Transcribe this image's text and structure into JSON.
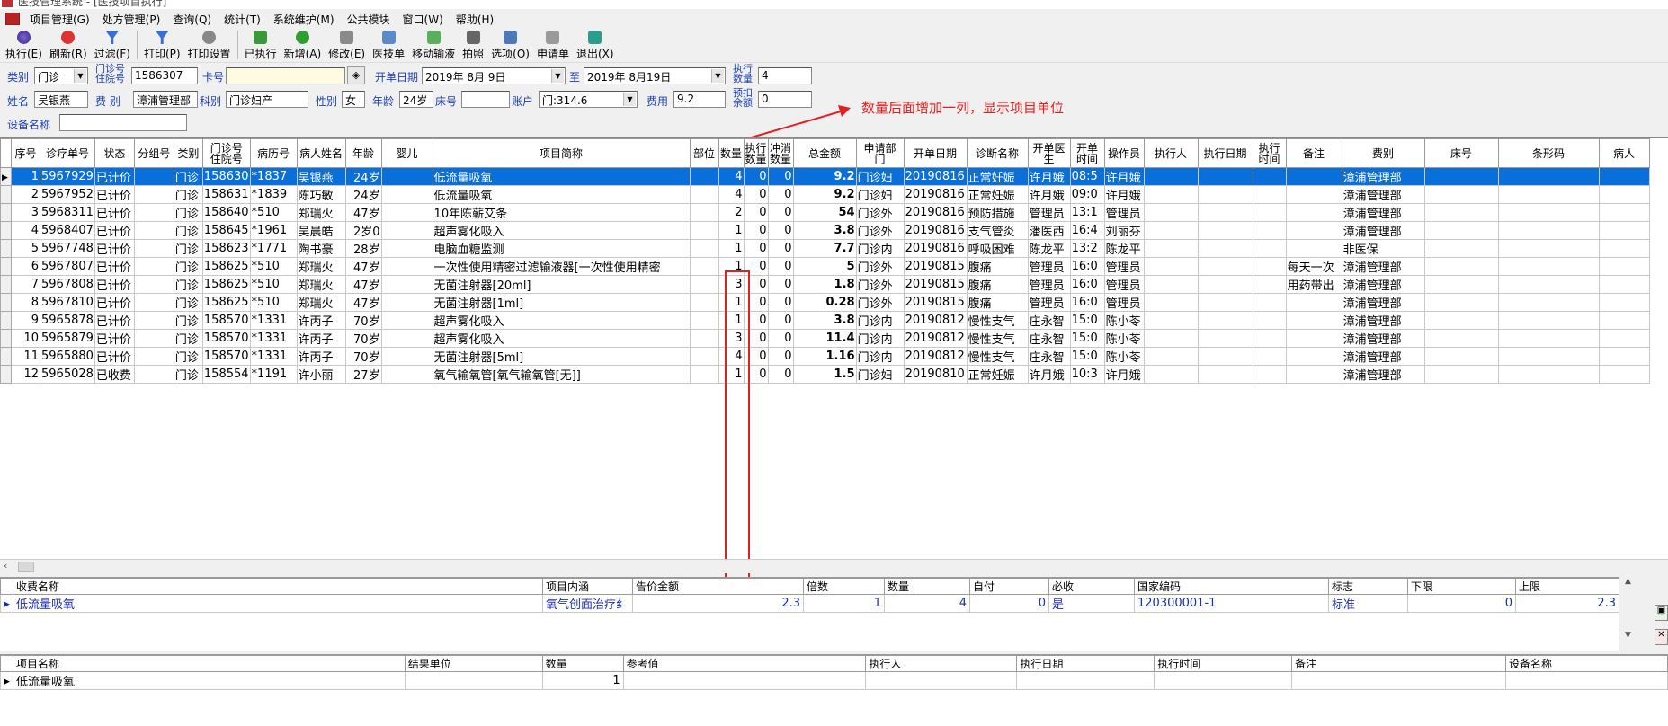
{
  "window": {
    "title": "医技管理系统 - [医技项目执行]"
  },
  "menu": [
    "项目管理(G)",
    "处方管理(P)",
    "查询(Q)",
    "统计(T)",
    "系统维护(M)",
    "公共模块",
    "窗口(W)",
    "帮助(H)"
  ],
  "toolbar": {
    "execute": "执行(E)",
    "refresh": "刷新(R)",
    "filter": "过滤(F)",
    "print": "打印(P)",
    "print_settings": "打印设置",
    "executed": "已执行",
    "add": "新增(A)",
    "modify": "修改(E)",
    "tech_order": "医技单",
    "mobile_infusion": "移动输液",
    "photo": "拍照",
    "options": "选项(O)",
    "request": "申请单",
    "exit": "退出(X)"
  },
  "colors": {
    "selected_row": "#0a6fd8",
    "label_blue": "#1a3fb3",
    "annotation_red": "#e12020",
    "value_blue": "#1b2ea8"
  },
  "filter": {
    "category_label": "类别",
    "category_value": "门诊",
    "clinic_no_label": "门诊号\n住院号",
    "clinic_no_value": "1586307",
    "card_label": "卡号",
    "card_value": "",
    "start_date_label": "开单日期",
    "start_date_value": "2019年 8月 9日",
    "to_label": "至",
    "end_date_value": "2019年 8月19日",
    "exec_qty_label": "执行\n数量",
    "exec_qty_value": "4",
    "name_label": "姓名",
    "name_value": "吴银燕",
    "fee_type_label": "费 别",
    "fee_type_value": "漳浦管理部",
    "dept_label": "科别",
    "dept_value": "门诊妇产",
    "sex_label": "性别",
    "sex_value": "女",
    "age_label": "年龄",
    "age_value": "24岁",
    "bed_label": "床号",
    "bed_value": "",
    "account_label": "账户",
    "account_value": "门:314.6",
    "cost_label": "费用",
    "cost_value": "9.2",
    "prepay_label": "预扣\n余额",
    "prepay_value": "0",
    "device_label": "设备名称",
    "device_value": ""
  },
  "annotation": "数量后面增加一列，显示项目单位",
  "main_table": {
    "headers": [
      "序号",
      "诊疗单号",
      "状态",
      "分组号",
      "类别",
      "门诊号\n住院号",
      "病历号",
      "病人姓名",
      "年龄",
      "婴儿",
      "项目简称",
      "部位",
      "数量",
      "执行\n数量",
      "冲消\n数量",
      "总金额",
      "申请部\n门",
      "开单日期",
      "诊断名称",
      "开单医\n生",
      "开单\n时间",
      "操作员",
      "执行人",
      "执行日期",
      "执行\n时间",
      "备注",
      "费别",
      "床号",
      "条形码",
      "病人"
    ],
    "rows": [
      [
        "1",
        "5967929",
        "已计价",
        "",
        "门诊",
        "158630",
        "*1837",
        "吴银燕",
        "24岁",
        "",
        "低流量吸氧",
        "",
        "4",
        "0",
        "0",
        "9.2",
        "门诊妇",
        "20190816",
        "正常妊娠",
        "许月娥",
        "08:5",
        "许月娥",
        "",
        "",
        "",
        "",
        "漳浦管理部",
        "",
        "",
        ""
      ],
      [
        "2",
        "5967952",
        "已计价",
        "",
        "门诊",
        "158631",
        "*1839",
        "陈巧敏",
        "24岁",
        "",
        "低流量吸氧",
        "",
        "4",
        "0",
        "0",
        "9.2",
        "门诊妇",
        "20190816",
        "正常妊娠",
        "许月娥",
        "09:0",
        "许月娥",
        "",
        "",
        "",
        "",
        "漳浦管理部",
        "",
        "",
        ""
      ],
      [
        "3",
        "5968311",
        "已计价",
        "",
        "门诊",
        "158640",
        "*510",
        "郑瑞火",
        "47岁",
        "",
        "10年陈蕲艾条",
        "",
        "2",
        "0",
        "0",
        "54",
        "门诊外",
        "20190816",
        "预防措施",
        "管理员",
        "13:1",
        "管理员",
        "",
        "",
        "",
        "",
        "漳浦管理部",
        "",
        "",
        ""
      ],
      [
        "4",
        "5968407",
        "已计价",
        "",
        "门诊",
        "158645",
        "*1961",
        "吴晨皓",
        "2岁0",
        "",
        "超声雾化吸入",
        "",
        "1",
        "0",
        "0",
        "3.8",
        "门诊外",
        "20190816",
        "支气管炎",
        "潘医西",
        "16:4",
        "刘丽芬",
        "",
        "",
        "",
        "",
        "漳浦管理部",
        "",
        "",
        ""
      ],
      [
        "5",
        "5967748",
        "已计价",
        "",
        "门诊",
        "158623",
        "*1771",
        "陶书豪",
        "28岁",
        "",
        "电脑血糖监测",
        "",
        "1",
        "0",
        "0",
        "7.7",
        "门诊内",
        "20190816",
        "呼吸困难",
        "陈龙平",
        "13:2",
        "陈龙平",
        "",
        "",
        "",
        "",
        "非医保",
        "",
        "",
        ""
      ],
      [
        "6",
        "5967807",
        "已计价",
        "",
        "门诊",
        "158625",
        "*510",
        "郑瑞火",
        "47岁",
        "",
        "一次性使用精密过滤输液器[一次性使用精密",
        "",
        "1",
        "0",
        "0",
        "5",
        "门诊外",
        "20190815",
        "腹痛",
        "管理员",
        "16:0",
        "管理员",
        "",
        "",
        "",
        "每天一次",
        "漳浦管理部",
        "",
        "",
        ""
      ],
      [
        "7",
        "5967808",
        "已计价",
        "",
        "门诊",
        "158625",
        "*510",
        "郑瑞火",
        "47岁",
        "",
        "无菌注射器[20ml]",
        "",
        "3",
        "0",
        "0",
        "1.8",
        "门诊外",
        "20190815",
        "腹痛",
        "管理员",
        "16:0",
        "管理员",
        "",
        "",
        "",
        "用药带出",
        "漳浦管理部",
        "",
        "",
        ""
      ],
      [
        "8",
        "5967810",
        "已计价",
        "",
        "门诊",
        "158625",
        "*510",
        "郑瑞火",
        "47岁",
        "",
        "无菌注射器[1ml]",
        "",
        "1",
        "0",
        "0",
        "0.28",
        "门诊外",
        "20190815",
        "腹痛",
        "管理员",
        "16:0",
        "管理员",
        "",
        "",
        "",
        "",
        "漳浦管理部",
        "",
        "",
        ""
      ],
      [
        "9",
        "5965878",
        "已计价",
        "",
        "门诊",
        "158570",
        "*1331",
        "许丙子",
        "70岁",
        "",
        "超声雾化吸入",
        "",
        "1",
        "0",
        "0",
        "3.8",
        "门诊内",
        "20190812",
        "慢性支气",
        "庄永智",
        "15:0",
        "陈小苓",
        "",
        "",
        "",
        "",
        "漳浦管理部",
        "",
        "",
        ""
      ],
      [
        "10",
        "5965879",
        "已计价",
        "",
        "门诊",
        "158570",
        "*1331",
        "许丙子",
        "70岁",
        "",
        "超声雾化吸入",
        "",
        "3",
        "0",
        "0",
        "11.4",
        "门诊内",
        "20190812",
        "慢性支气",
        "庄永智",
        "15:0",
        "陈小苓",
        "",
        "",
        "",
        "",
        "漳浦管理部",
        "",
        "",
        ""
      ],
      [
        "11",
        "5965880",
        "已计价",
        "",
        "门诊",
        "158570",
        "*1331",
        "许丙子",
        "70岁",
        "",
        "无菌注射器[5ml]",
        "",
        "4",
        "0",
        "0",
        "1.16",
        "门诊内",
        "20190812",
        "慢性支气",
        "庄永智",
        "15:0",
        "陈小苓",
        "",
        "",
        "",
        "",
        "漳浦管理部",
        "",
        "",
        ""
      ],
      [
        "12",
        "5965028",
        "已收费",
        "",
        "门诊",
        "158554",
        "*1191",
        "许小丽",
        "27岁",
        "",
        "氧气输氧管[氧气输氧管[无]]",
        "",
        "1",
        "0",
        "0",
        "1.5",
        "门诊妇",
        "20190810",
        "正常妊娠",
        "许月娥",
        "10:3",
        "许月娥",
        "",
        "",
        "",
        "",
        "漳浦管理部",
        "",
        "",
        ""
      ]
    ]
  },
  "fee_table": {
    "headers": [
      "收费名称",
      "项目内涵",
      "告价金额",
      "倍数",
      "数量",
      "自付",
      "必收",
      "国家编码",
      "标志",
      "下限",
      "上限"
    ],
    "rows": [
      [
        "低流量吸氧",
        "氧气创面治疗纟",
        "2.3",
        "1",
        "4",
        "0",
        "是",
        "120300001-1",
        "标准",
        "0",
        "2.3"
      ]
    ]
  },
  "item_table": {
    "headers": [
      "项目名称",
      "结果单位",
      "数量",
      "参考值",
      "执行人",
      "执行日期",
      "执行时间",
      "备注",
      "设备名称"
    ],
    "rows": [
      [
        "低流量吸氧",
        "",
        "1",
        "",
        "",
        "",
        "",
        "",
        ""
      ]
    ]
  }
}
